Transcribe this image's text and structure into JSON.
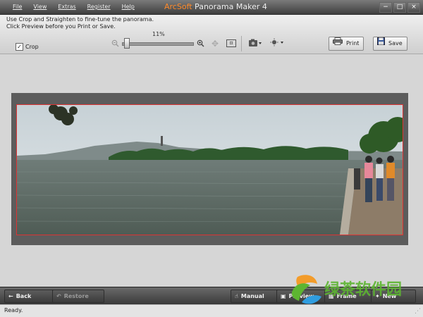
{
  "menu": [
    "File",
    "View",
    "Extras",
    "Register",
    "Help"
  ],
  "app_title_brand": "ArcSoft",
  "app_title_rest": " Panorama Maker 4",
  "window_controls": [
    "−",
    "□",
    "×"
  ],
  "toolbar": {
    "hint_line1": "Use Crop and Straighten to fine-tune the panorama.",
    "hint_line2": "Click Preview before you Print or Save.",
    "crop_label": "Crop",
    "crop_checked": true,
    "zoom_label": "11%",
    "zoom_value": 11,
    "print_label": "Print",
    "save_label": "Save"
  },
  "icons": {
    "zoom_out": "zoom-out-icon",
    "zoom_in": "zoom-in-icon",
    "pan": "pan-icon",
    "fit": "fit-window-icon",
    "camera": "camera-icon",
    "brightness": "brightness-icon",
    "print": "printer-icon",
    "save": "floppy-disk-icon"
  },
  "bottom": {
    "back_label": "Back",
    "restore_label": "Restore",
    "manual_label": "Manual",
    "preview_label": "Preview",
    "frame_label": "Frame",
    "new_label": "New"
  },
  "status_text": "Ready.",
  "watermark_text": "绿茶软件园",
  "colors": {
    "brand_orange": "#ff8a2a",
    "crop_border": "#dd3333",
    "watermark_green": "#5db531"
  }
}
